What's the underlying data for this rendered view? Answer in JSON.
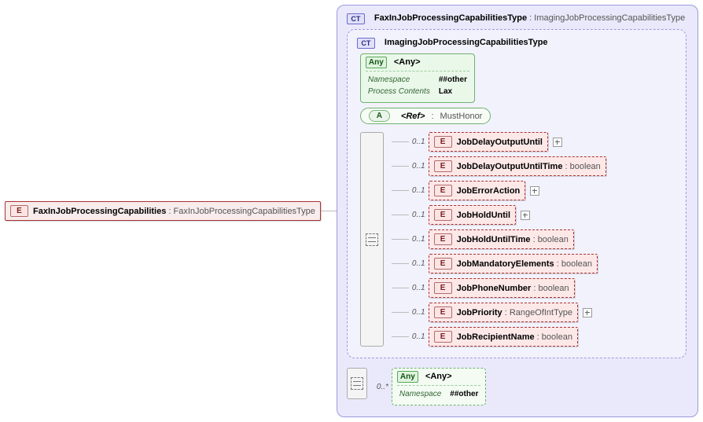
{
  "root": {
    "tag": "E",
    "name": "FaxInJobProcessingCapabilities",
    "type": "FaxInJobProcessingCapabilitiesType"
  },
  "ctOuter": {
    "tag": "CT",
    "name": "FaxInJobProcessingCapabilitiesType",
    "extends": "ImagingJobProcessingCapabilitiesType"
  },
  "ctInner": {
    "tag": "CT",
    "name": "ImagingJobProcessingCapabilitiesType"
  },
  "anyTop": {
    "tag": "Any",
    "label": "<Any>",
    "nsKey": "Namespace",
    "nsVal": "##other",
    "pcKey": "Process Contents",
    "pcVal": "Lax"
  },
  "attrRef": {
    "tag": "A",
    "label": "<Ref>",
    "type": "MustHonor"
  },
  "children": [
    {
      "card": "0..1",
      "name": "JobDelayOutputUntil",
      "type": "",
      "expand": true,
      "dashed": true
    },
    {
      "card": "0..1",
      "name": "JobDelayOutputUntilTime",
      "type": "boolean",
      "expand": false,
      "dashed": true
    },
    {
      "card": "0..1",
      "name": "JobErrorAction",
      "type": "",
      "expand": true,
      "dashed": true
    },
    {
      "card": "0..1",
      "name": "JobHoldUntil",
      "type": "",
      "expand": true,
      "dashed": true
    },
    {
      "card": "0..1",
      "name": "JobHoldUntilTime",
      "type": "boolean",
      "expand": false,
      "dashed": true
    },
    {
      "card": "0..1",
      "name": "JobMandatoryElements",
      "type": "boolean",
      "expand": false,
      "dashed": true
    },
    {
      "card": "0..1",
      "name": "JobPhoneNumber",
      "type": "boolean",
      "expand": false,
      "dashed": true
    },
    {
      "card": "0..1",
      "name": "JobPriority",
      "type": "RangeOfIntType",
      "expand": true,
      "dashed": true
    },
    {
      "card": "0..1",
      "name": "JobRecipientName",
      "type": "boolean",
      "expand": false,
      "dashed": true
    }
  ],
  "anyBottom": {
    "card": "0..*",
    "tag": "Any",
    "label": "<Any>",
    "nsKey": "Namespace",
    "nsVal": "##other"
  }
}
